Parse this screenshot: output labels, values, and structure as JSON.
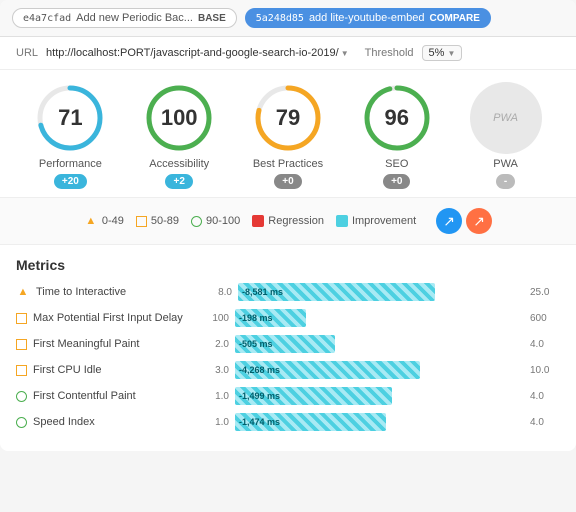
{
  "topbar": {
    "base_hash": "e4a7cfad",
    "base_desc": "Add new Periodic Bac...",
    "base_badge": "BASE",
    "compare_hash": "5a248d85",
    "compare_desc": "add lite-youtube-embed",
    "compare_badge": "COMPARE"
  },
  "urlbar": {
    "label": "URL",
    "url": "http://localhost:PORT/javascript-and-google-search-io-2019/",
    "threshold_label": "Threshold",
    "threshold_value": "5%"
  },
  "scores": [
    {
      "label": "Performance",
      "value": "71",
      "delta": "+20",
      "delta_type": "positive",
      "color": "#3ab5dc",
      "ring_color": "#3ab5dc",
      "ring_pct": 71
    },
    {
      "label": "Accessibility",
      "value": "100",
      "delta": "+2",
      "delta_type": "positive",
      "color": "#3ab5dc",
      "ring_color": "#4caf50",
      "ring_pct": 100
    },
    {
      "label": "Best Practices",
      "value": "79",
      "delta": "+0",
      "delta_type": "zero",
      "color": "#888",
      "ring_color": "#f5a623",
      "ring_pct": 79
    },
    {
      "label": "SEO",
      "value": "96",
      "delta": "+0",
      "delta_type": "zero",
      "color": "#888",
      "ring_color": "#4caf50",
      "ring_pct": 96
    },
    {
      "label": "PWA",
      "delta": "-",
      "delta_type": "dash",
      "is_pwa": true
    }
  ],
  "legend": {
    "items": [
      {
        "type": "triangle",
        "label": "0-49"
      },
      {
        "type": "square",
        "label": "50-89"
      },
      {
        "type": "circle",
        "label": "90-100"
      },
      {
        "type": "regression",
        "label": "Regression"
      },
      {
        "type": "improvement",
        "label": "Improvement"
      }
    ]
  },
  "metrics": {
    "title": "Metrics",
    "rows": [
      {
        "icon": "triangle",
        "name": "Time to Interactive",
        "base": "8.0",
        "delta_text": "-8,581 ms",
        "bar_width_pct": 70,
        "threshold": "25.0"
      },
      {
        "icon": "square",
        "name": "Max Potential First Input Delay",
        "base": "100",
        "delta_text": "-198 ms",
        "bar_width_pct": 25,
        "threshold": "600"
      },
      {
        "icon": "square",
        "name": "First Meaningful Paint",
        "base": "2.0",
        "delta_text": "-505 ms",
        "bar_width_pct": 35,
        "threshold": "4.0"
      },
      {
        "icon": "square",
        "name": "First CPU Idle",
        "base": "3.0",
        "delta_text": "-4,268 ms",
        "bar_width_pct": 65,
        "threshold": "10.0"
      },
      {
        "icon": "circle",
        "name": "First Contentful Paint",
        "base": "1.0",
        "delta_text": "-1,499 ms",
        "bar_width_pct": 55,
        "threshold": "4.0"
      },
      {
        "icon": "circle",
        "name": "Speed Index",
        "base": "1.0",
        "delta_text": "-1,474 ms",
        "bar_width_pct": 53,
        "threshold": "4.0"
      }
    ]
  }
}
